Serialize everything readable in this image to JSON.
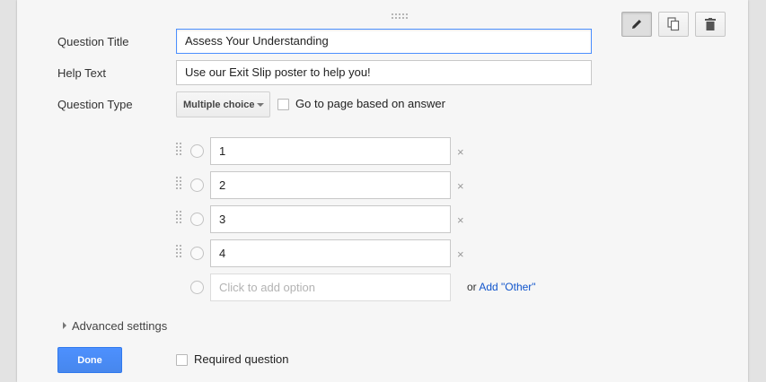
{
  "toolbar": {
    "edit_icon": "pencil-icon",
    "duplicate_icon": "duplicate-icon",
    "delete_icon": "trash-icon"
  },
  "form": {
    "question_title_label": "Question Title",
    "question_title_value": "Assess Your Understanding",
    "help_text_label": "Help Text",
    "help_text_value": "Use our Exit Slip poster to help you!",
    "question_type_label": "Question Type",
    "question_type_value": "Multiple choice",
    "go_to_page_label": "Go to page based on answer"
  },
  "options": [
    {
      "value": "1"
    },
    {
      "value": "2"
    },
    {
      "value": "3"
    },
    {
      "value": "4"
    }
  ],
  "remove_symbol": "×",
  "add_option_placeholder": "Click to add option",
  "add_other_prefix": "or",
  "add_other_link": "Add \"Other\"",
  "advanced_settings_label": "Advanced settings",
  "done_label": "Done",
  "required_question_label": "Required question",
  "colors": {
    "primary_button": "#4d90fe",
    "link": "#1155cc",
    "focus_border": "#4d90fe"
  }
}
